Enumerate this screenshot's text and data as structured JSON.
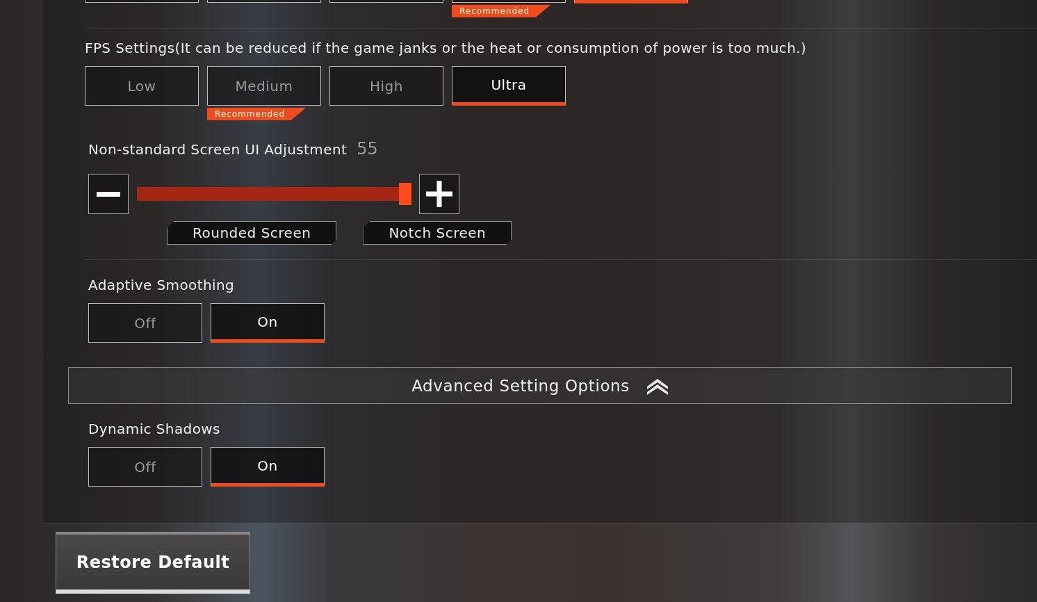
{
  "previous_setting": {
    "options": [
      {
        "selected": false,
        "recommended": false
      },
      {
        "selected": false,
        "recommended": false
      },
      {
        "selected": false,
        "recommended": false
      },
      {
        "selected": false,
        "recommended": true
      },
      {
        "selected": true,
        "recommended": false
      }
    ],
    "recommended_label": "Recommended"
  },
  "fps_settings": {
    "label": "FPS Settings(It can be reduced if the game janks or the heat or consumption of power is too much.)",
    "options": [
      {
        "label": "Low",
        "selected": false,
        "recommended": false
      },
      {
        "label": "Medium",
        "selected": false,
        "recommended": true
      },
      {
        "label": "High",
        "selected": false,
        "recommended": false
      },
      {
        "label": "Ultra",
        "selected": true,
        "recommended": false
      }
    ],
    "recommended_label": "Recommended"
  },
  "ui_adjustment": {
    "label": "Non-standard Screen UI Adjustment",
    "value": "55",
    "level": 0.98,
    "markers": [
      "Rounded Screen",
      "Notch Screen"
    ]
  },
  "adaptive_smoothing": {
    "label": "Adaptive Smoothing",
    "options": [
      {
        "label": "Off",
        "selected": false
      },
      {
        "label": "On",
        "selected": true
      }
    ]
  },
  "advanced": {
    "label": "Advanced Setting Options",
    "expanded": true
  },
  "dynamic_shadows": {
    "label": "Dynamic Shadows",
    "options": [
      {
        "label": "Off",
        "selected": false
      },
      {
        "label": "On",
        "selected": true
      }
    ]
  },
  "restore_button": "Restore Default"
}
